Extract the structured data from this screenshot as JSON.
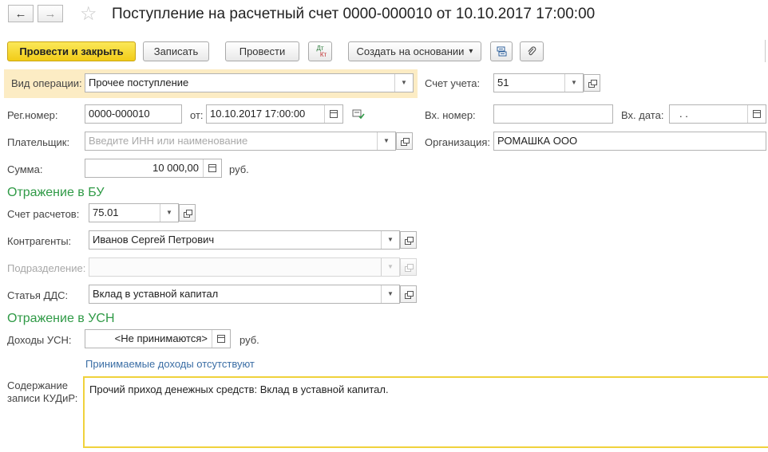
{
  "window": {
    "title": "Поступление на расчетный счет 0000-000010 от 10.10.2017 17:00:00",
    "nav_back_icon": "arrow-left-icon",
    "nav_forward_icon": "arrow-right-icon",
    "favorite_icon": "star-icon"
  },
  "toolbar": {
    "post_and_close": "Провести и закрыть",
    "save": "Записать",
    "post": "Провести",
    "dt_top": "Дт",
    "dt_bottom": "Кт",
    "create_based_on": "Создать на основании",
    "create_arrow": "▾"
  },
  "form": {
    "operation_type": {
      "label": "Вид операции:",
      "value": "Прочее поступление"
    },
    "account": {
      "label": "Счет учета:",
      "value": "51"
    },
    "reg_number": {
      "label": "Рег.номер:",
      "value": "0000-000010"
    },
    "date": {
      "label": "от:",
      "value": "10.10.2017 17:00:00"
    },
    "in_number": {
      "label": "Вх. номер:",
      "value": ""
    },
    "in_date": {
      "label": "Вх. дата:",
      "value": " .  ."
    },
    "payer": {
      "label": "Плательщик:",
      "placeholder": "Введите ИНН или наименование"
    },
    "organization": {
      "label": "Организация:",
      "value": "РОМАШКА ООО"
    },
    "sum": {
      "label": "Сумма:",
      "value": "10 000,00",
      "currency": "руб."
    }
  },
  "bu_section": {
    "title": "Отражение в БУ",
    "settlement_account": {
      "label": "Счет расчетов:",
      "value": "75.01"
    },
    "counterparties": {
      "label": "Контрагенты:",
      "value": "Иванов Сергей Петрович"
    },
    "division": {
      "label": "Подразделение:",
      "value": ""
    },
    "dds_item": {
      "label": "Статья ДДС:",
      "value": "Вклад в уставной капитал"
    }
  },
  "usn_section": {
    "title": "Отражение в УСН",
    "income": {
      "label": "Доходы УСН:",
      "value": "<Не принимаются>",
      "currency": "руб."
    },
    "link": "Принимаемые доходы отсутствуют",
    "kudir_label_line1": "Содержание",
    "kudir_label_line2": "записи КУДиР:",
    "kudir_text": "Прочий приход денежных средств: Вклад в уставной капитал."
  }
}
